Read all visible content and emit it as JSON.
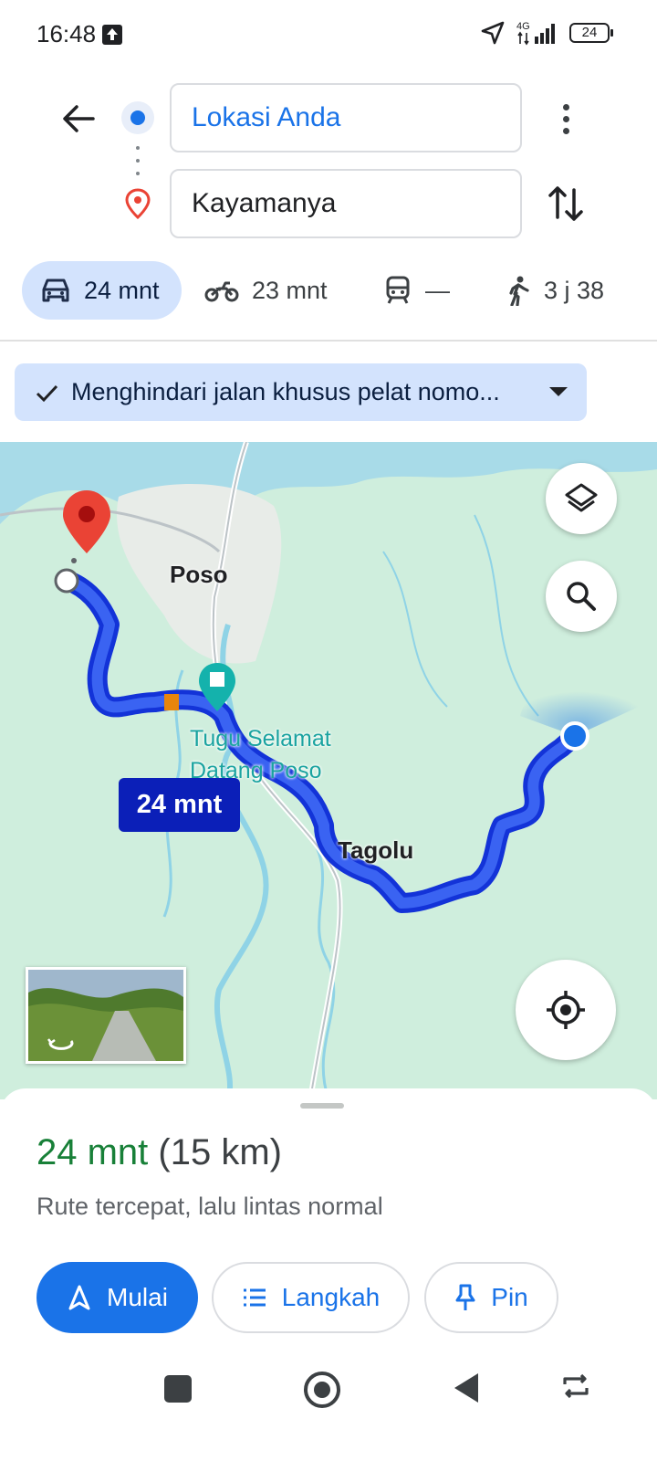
{
  "status_bar": {
    "time": "16:48",
    "network": "4G",
    "battery": "24",
    "icons": [
      "upload-icon",
      "location-arrow-icon",
      "signal-icon",
      "battery-icon"
    ]
  },
  "search": {
    "origin": "Lokasi Anda",
    "destination": "Kayamanya"
  },
  "travel_modes": [
    {
      "mode": "car",
      "icon": "car-icon",
      "label": "24 mnt",
      "selected": true
    },
    {
      "mode": "motorcycle",
      "icon": "motorcycle-icon",
      "label": "23 mnt"
    },
    {
      "mode": "transit",
      "icon": "train-icon",
      "label": "—"
    },
    {
      "mode": "walk",
      "icon": "walk-icon",
      "label": "3 j 38"
    }
  ],
  "route_option": {
    "label": "Menghindari jalan khusus pelat nomo...",
    "icon": "check-icon"
  },
  "map": {
    "labels": {
      "city": "Poso",
      "landmark": "Tugu Selamat Datang Poso",
      "village": "Tagolu"
    },
    "route_badge": "24 mnt",
    "colors": {
      "route": "#1a35e8",
      "water": "#a8dbe8",
      "land": "#cfeedd",
      "destination_pin": "#ea4335"
    }
  },
  "summary": {
    "duration": "24 mnt",
    "distance": "(15 km)",
    "description": "Rute tercepat, lalu lintas normal"
  },
  "actions": {
    "start": "Mulai",
    "steps": "Langkah",
    "pin": "Pin"
  },
  "colors": {
    "accent": "#1a73e8",
    "chip_bg": "#d3e3fd",
    "duration_green": "#188038"
  }
}
